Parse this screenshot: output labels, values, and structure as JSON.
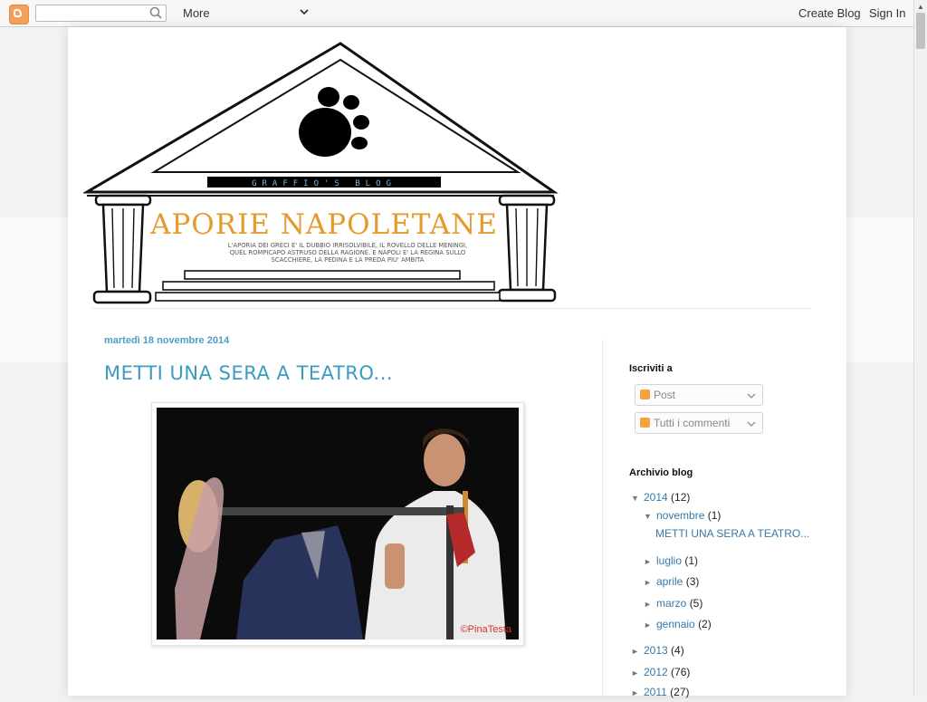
{
  "navbar": {
    "more_label": "More",
    "create_blog": "Create Blog",
    "sign_in": "Sign In"
  },
  "header": {
    "subtitle": "GRAFFIO'S BLOG",
    "title": "APORIE NAPOLETANE",
    "tagline_1": "L'APORIA DEI GRECI E' IL DUBBIO IRRISOLVIBILE, IL ROVELLO DELLE MENINGI,",
    "tagline_2": "QUEL ROMPICAPO ASTRUSO DELLA RAGIONE. E NAPOLI E' LA REGINA SULLO",
    "tagline_3": "SCACCHIERE, LA PEDINA E LA PREDA PIU' AMBITA"
  },
  "post": {
    "date": "martedì 18 novembre 2014",
    "title": "METTI UNA SERA A TEATRO...",
    "photo_credit": "©PinaTesta"
  },
  "sidebar": {
    "subscribe_heading": "Iscriviti a",
    "subscribe_posts": "Post",
    "subscribe_comments": "Tutti i commenti",
    "archive_heading": "Archivio blog",
    "archive": [
      {
        "label": "2014",
        "count": "(12)",
        "expanded": true
      },
      {
        "label": "novembre",
        "count": "(1)",
        "expanded": true
      },
      {
        "label": "METTI UNA SERA A TEATRO..."
      },
      {
        "label": "luglio",
        "count": "(1)"
      },
      {
        "label": "aprile",
        "count": "(3)"
      },
      {
        "label": "marzo",
        "count": "(5)"
      },
      {
        "label": "gennaio",
        "count": "(2)"
      },
      {
        "label": "2013",
        "count": "(4)"
      },
      {
        "label": "2012",
        "count": "(76)"
      },
      {
        "label": "2011",
        "count": "(27)"
      }
    ]
  },
  "colors": {
    "accent": "#3b9bc0",
    "title_orange": "#e59a2c",
    "feed_orange": "#f5a23d"
  }
}
